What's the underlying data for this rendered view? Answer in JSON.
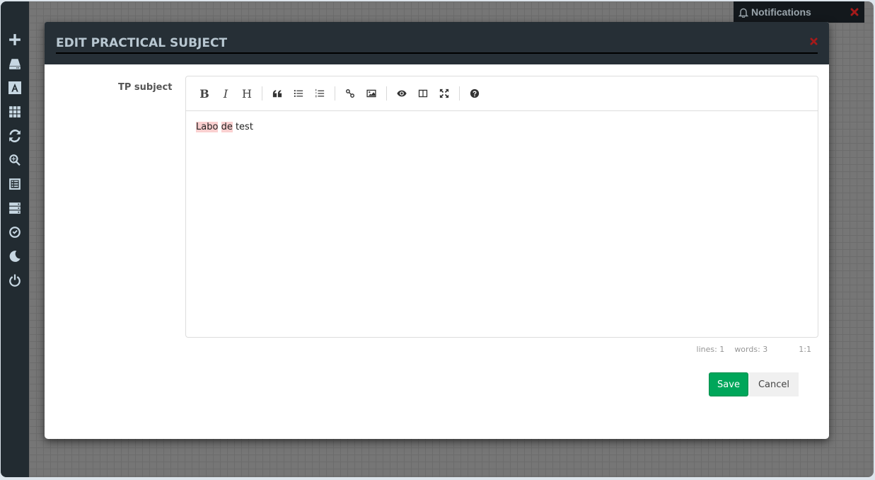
{
  "sidebar": {
    "items": [
      {
        "icon": "plus-icon",
        "label": "Add"
      },
      {
        "icon": "hard-drive-icon",
        "label": "Storage"
      },
      {
        "icon": "font-icon",
        "label": "Text"
      },
      {
        "icon": "grid-icon",
        "label": "Grid"
      },
      {
        "icon": "refresh-icon",
        "label": "Refresh"
      },
      {
        "icon": "zoom-in-icon",
        "label": "Search"
      },
      {
        "icon": "list-icon",
        "label": "List"
      },
      {
        "icon": "server-icon",
        "label": "Servers"
      },
      {
        "icon": "check-circle-icon",
        "label": "Validate"
      },
      {
        "icon": "moon-icon",
        "label": "Dark mode"
      },
      {
        "icon": "power-icon",
        "label": "Logout"
      }
    ]
  },
  "notifications": {
    "label": "Notifications",
    "close_icon": "close-icon",
    "close_color": "#a51a1a"
  },
  "modal": {
    "title": "EDIT PRACTICAL SUBJECT",
    "field_label": "TP subject",
    "editor": {
      "toolbar": [
        {
          "name": "bold",
          "glyph": "B"
        },
        {
          "name": "italic",
          "glyph": "I"
        },
        {
          "name": "heading",
          "glyph": "H"
        },
        {
          "name": "quote"
        },
        {
          "name": "unordered-list"
        },
        {
          "name": "ordered-list"
        },
        {
          "name": "link"
        },
        {
          "name": "image"
        },
        {
          "name": "preview"
        },
        {
          "name": "side-by-side"
        },
        {
          "name": "fullscreen"
        },
        {
          "name": "guide"
        }
      ],
      "content": {
        "word1": "Labo",
        "word2": "de",
        "word3": "test"
      },
      "status": {
        "lines": "lines: 1",
        "words": "words: 3",
        "cursor": "1:1"
      }
    },
    "save_label": "Save",
    "cancel_label": "Cancel"
  },
  "colors": {
    "sidebar_bg": "#222b31",
    "header_bg": "#262f36",
    "save_green": "#00a65a",
    "spell_highlight": "#fad0d0"
  }
}
